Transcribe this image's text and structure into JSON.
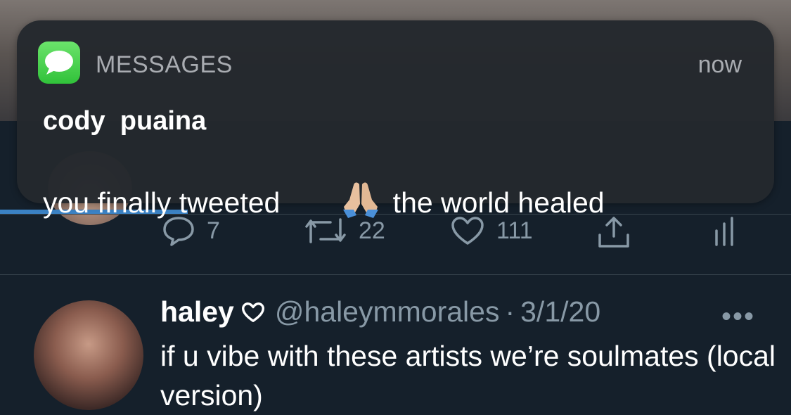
{
  "notification": {
    "app_name": "MESSAGES",
    "time": "now",
    "sender": "cody  puaina",
    "message_before": "you finally tweeted",
    "emoji": "folded-hands-emoji",
    "message_after": "the world healed"
  },
  "prev_tweet_actions": {
    "reply_count": "7",
    "retweet_count": "22",
    "like_count": "111"
  },
  "tweet": {
    "name": "haley",
    "handle": "@haleymmorales",
    "separator": "·",
    "date": "3/1/20",
    "more": "•••",
    "text": "if u vibe with these artists we’re soulmates (local version)"
  },
  "colors": {
    "background": "#15202b",
    "secondary_text": "#8899a6",
    "accent": "#3b82c4",
    "imessage_green": "#34c759"
  }
}
